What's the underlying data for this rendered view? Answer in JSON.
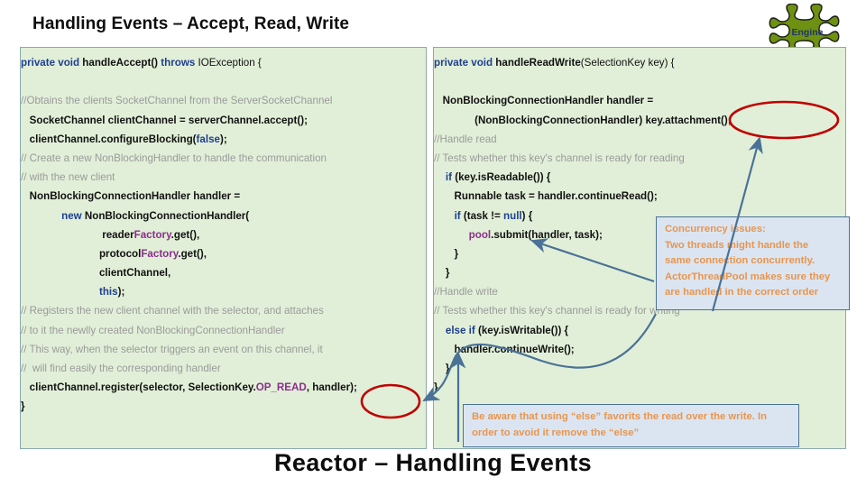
{
  "slide": {
    "title": "Handling Events – Accept, Read, Write",
    "footer_title": "Reactor – Handling Events",
    "badge_label": "Engine",
    "colors": {
      "code_background": "#e1efd8",
      "code_border": "#8ba8ad",
      "callout_background": "#dbe5f1",
      "callout_border": "#4a7296",
      "callout_text": "#e8954e",
      "keyword": "#1f3f8f",
      "comment": "#9a9a9a",
      "field": "#8b2e8b",
      "badge_fill": "#6e9112",
      "badge_label_color": "#1f3864",
      "ellipse_stroke": "#c00000",
      "arrow_stroke": "#4a7296"
    }
  },
  "code_left": {
    "lines": [
      [
        {
          "t": "private void ",
          "c": "kw"
        },
        {
          "t": "handleAccept()",
          "c": "b"
        },
        {
          "t": " ",
          "c": "plain"
        },
        {
          "t": "throws",
          "c": "kw"
        },
        {
          "t": " IOException {",
          "c": "plain"
        }
      ],
      [],
      [
        {
          "t": "//Obtains the clients SocketChannel from the ServerSocketChannel",
          "c": "cmt"
        }
      ],
      [
        {
          "t": "   SocketChannel clientChannel = serverChannel.accept();",
          "c": "b"
        }
      ],
      [
        {
          "t": "   clientChannel.configureBlocking(",
          "c": "b"
        },
        {
          "t": "false",
          "c": "kw"
        },
        {
          "t": ");",
          "c": "b"
        }
      ],
      [
        {
          "t": "// Create a new NonBlockingHandler to handle the communication",
          "c": "cmt"
        }
      ],
      [
        {
          "t": "// with the new client",
          "c": "cmt"
        }
      ],
      [
        {
          "t": "   NonBlockingConnectionHandler handler =",
          "c": "b"
        }
      ],
      [
        {
          "t": "              ",
          "c": "plain"
        },
        {
          "t": "new",
          "c": "kw"
        },
        {
          "t": " NonBlockingConnectionHandler(",
          "c": "b"
        }
      ],
      [
        {
          "t": "                            reader",
          "c": "b"
        },
        {
          "t": "Factory",
          "c": "mag"
        },
        {
          "t": ".get(),",
          "c": "b"
        }
      ],
      [
        {
          "t": "                           protocol",
          "c": "b"
        },
        {
          "t": "Factory",
          "c": "mag"
        },
        {
          "t": ".get(),",
          "c": "b"
        }
      ],
      [
        {
          "t": "                           clientChannel,",
          "c": "b"
        }
      ],
      [
        {
          "t": "                           ",
          "c": "b"
        },
        {
          "t": "this",
          "c": "kw"
        },
        {
          "t": ");",
          "c": "b"
        }
      ],
      [
        {
          "t": "// Registers the new client channel with the selector, and attaches",
          "c": "cmt"
        }
      ],
      [
        {
          "t": "// to it the newlly created NonBlockingConnectionHandler",
          "c": "cmt"
        }
      ],
      [
        {
          "t": "// This way, when the selector triggers an event on this channel, it",
          "c": "cmt"
        }
      ],
      [
        {
          "t": "//  will find easily the corresponding handler",
          "c": "cmt"
        }
      ],
      [
        {
          "t": "   clientChannel.register(selector, SelectionKey.",
          "c": "b"
        },
        {
          "t": "OP_READ",
          "c": "mag"
        },
        {
          "t": ", handler);",
          "c": "b"
        }
      ],
      [
        {
          "t": "}",
          "c": "b"
        }
      ]
    ]
  },
  "code_right": {
    "lines": [
      [
        {
          "t": "private void ",
          "c": "kw"
        },
        {
          "t": "handleReadWrite",
          "c": "b"
        },
        {
          "t": "(SelectionKey key) {",
          "c": "plain"
        }
      ],
      [],
      [
        {
          "t": "   NonBlockingConnectionHandler handler =",
          "c": "b"
        }
      ],
      [
        {
          "t": "              (NonBlockingConnectionHandler) key.attachment();",
          "c": "b"
        }
      ],
      [
        {
          "t": "//Handle read",
          "c": "cmt"
        }
      ],
      [
        {
          "t": "// Tests whether this key's channel is ready for reading",
          "c": "cmt"
        }
      ],
      [
        {
          "t": "    ",
          "c": "plain"
        },
        {
          "t": "if",
          "c": "kw"
        },
        {
          "t": " (key.isReadable()) {",
          "c": "b"
        }
      ],
      [
        {
          "t": "       Runnable task = handler.continueRead();",
          "c": "b"
        }
      ],
      [
        {
          "t": "       ",
          "c": "plain"
        },
        {
          "t": "if",
          "c": "kw"
        },
        {
          "t": " (task != ",
          "c": "b"
        },
        {
          "t": "null",
          "c": "kw"
        },
        {
          "t": ") {",
          "c": "b"
        }
      ],
      [
        {
          "t": "            ",
          "c": "plain"
        },
        {
          "t": "pool",
          "c": "mag"
        },
        {
          "t": ".submit(handler, task);",
          "c": "b"
        }
      ],
      [
        {
          "t": "       }",
          "c": "b"
        }
      ],
      [
        {
          "t": "    }",
          "c": "b"
        }
      ],
      [
        {
          "t": "//Handle write",
          "c": "cmt"
        }
      ],
      [
        {
          "t": "// Tests whether this key's channel is ready for writing",
          "c": "cmt"
        }
      ],
      [
        {
          "t": "    ",
          "c": "plain"
        },
        {
          "t": "else if",
          "c": "kw"
        },
        {
          "t": " (key.isWritable()) {",
          "c": "b"
        }
      ],
      [
        {
          "t": "       handler.continueWrite();",
          "c": "b"
        }
      ],
      [
        {
          "t": "    }",
          "c": "b"
        }
      ],
      [
        {
          "t": "}",
          "c": "b"
        }
      ]
    ]
  },
  "callouts": {
    "concurrency": [
      "Concurrency issues:",
      "Two threads might handle the",
      "same connection concurrently.",
      "ActorThreadPool makes sure they",
      "are handled in the correct order"
    ],
    "else_note": [
      "Be aware that using “else” favorits the read over the write. In",
      "order to avoid it remove the “else”"
    ]
  },
  "annotations": {
    "ellipse_handler_label": "handler",
    "ellipse_attachment_label": "key.attachment()",
    "arrow_attachment_to_handler": "attachment-to-handler-arrow",
    "arrow_pool_to_callout": "pool-submit-callout-arrow",
    "arrow_else_to_callout": "else-branch-callout-arrow"
  }
}
